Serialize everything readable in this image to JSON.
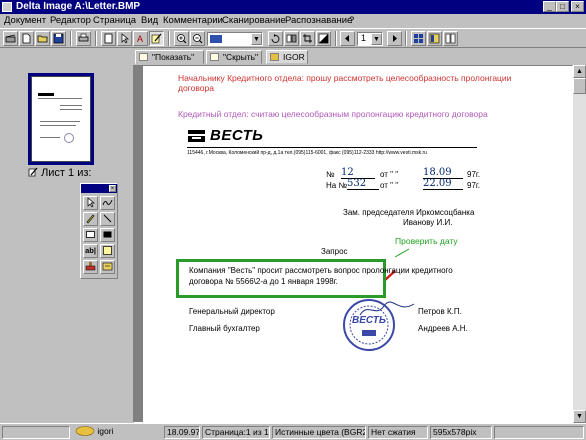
{
  "window": {
    "title": "Delta Image A:\\Letter.BMP",
    "minimize": "_",
    "maximize": "□",
    "close": "×"
  },
  "menu": [
    "Документ",
    "Редактор",
    "Страница",
    "Вид",
    "Комментарии",
    "Сканирование",
    "Распознавание",
    "?"
  ],
  "toolbar": {
    "zoom_value": "",
    "page_number": "1"
  },
  "tabs": [
    {
      "label": "\"Показать\""
    },
    {
      "label": "\"Скрыть\""
    },
    {
      "label": "IGOR"
    }
  ],
  "left_panel": {
    "sheet_label": "Лист 1 из:"
  },
  "palette": {
    "text_tool": "ab|"
  },
  "document": {
    "comment_red": "Начальнику Кредитного отдела: прошу рассмотреть целесообразность пролонгации договора",
    "comment_purple": "Кредитный отдел: считаю целесообразным пролонгацию кредитного договора",
    "logo_text": "ВЕСТЬ",
    "address": "115446, г.Москва, Коломенский пр-д, д.1а    тел.(095)115-6001,  факс (095)112-2333  http://www.vesti.msk.ru",
    "ref1_label": "№",
    "ref1_number": "12",
    "ref1_from": "от \" \"",
    "ref1_date": "18.09",
    "ref1_year": "97г.",
    "ref2_label": "На №",
    "ref2_number": "532",
    "ref2_from": "от \" \"",
    "ref2_date": "22.09",
    "ref2_year": "97г.",
    "addressee_line1": "Зам. председателя Иркомсоцбанка",
    "addressee_line2": "Иванову И.И.",
    "request_title": "Запрос",
    "comment_green": "Проверить дату",
    "body": "Компания \"Весть\" просит рассмотреть вопрос пролонгации кредитного договора № 5566\\2-а до 1 января 1998г.",
    "sig1_title": "Генеральный директор",
    "sig1_name": "Петров К.П.",
    "sig2_title": "Главный бухгалтер",
    "sig2_name": "Андреев А.Н.",
    "stamp_text": "ВЕСТЬ"
  },
  "status": {
    "user": "igori",
    "date": "18.09.97",
    "page": "Страница:1 из 1",
    "colors": "Истинные цвета (BGR24 bit)",
    "compression": "Нет сжатия",
    "size": "595x578pix"
  },
  "colors": {
    "title_bar": "#000080",
    "comment_red": "#d03030",
    "comment_purple": "#b058b8",
    "comment_green": "#20a020",
    "highlight_box": "#2a9a2a"
  }
}
